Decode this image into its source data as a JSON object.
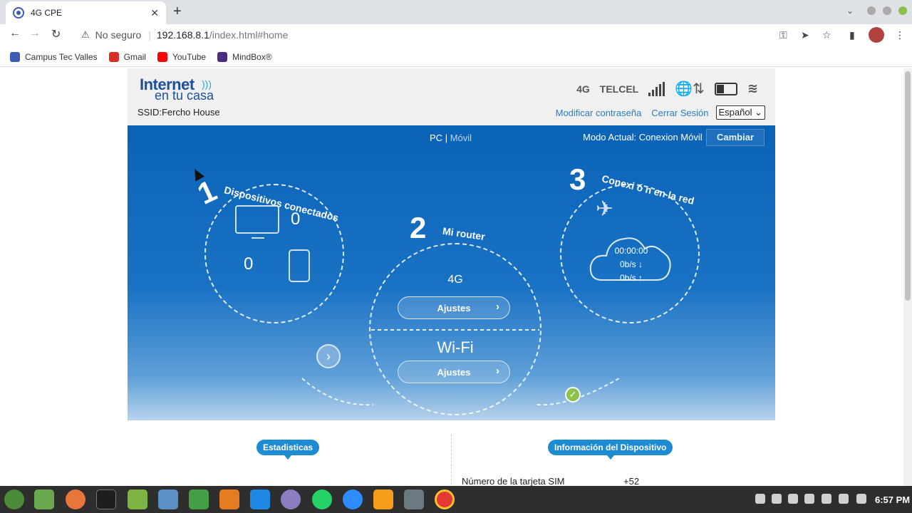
{
  "browser": {
    "tab_title": "4G CPE",
    "tab_close": "✕",
    "new_tab": "+",
    "security_label": "No seguro",
    "url_host": "192.168.8.1",
    "url_path": "/index.html#home",
    "bookmarks": [
      {
        "label": "Campus Tec Valles",
        "color": "#3b5bb5"
      },
      {
        "label": "Gmail",
        "color": "#d93025"
      },
      {
        "label": "YouTube",
        "color": "#ff0000"
      },
      {
        "label": "MindBox®",
        "color": "#4b2e83"
      }
    ]
  },
  "header": {
    "logo_line1": "Internet",
    "logo_line2": "en tu casa",
    "ssid": "SSID:Fercho House",
    "network_type": "4G",
    "carrier": "TELCEL",
    "modify_password": "Modificar contraseña",
    "logout": "Cerrar Sesión",
    "language": "Español"
  },
  "banner": {
    "view_pc": "PC",
    "view_separator": "|",
    "view_mobile": "Móvil",
    "mode_current": "Modo Actual: Conexion Móvil",
    "change_button": "Cambiar",
    "step1_number": "1",
    "step1_label": "Dispositivos conectados",
    "pc_count": "0",
    "mobile_count": "0",
    "step2_number": "2",
    "step2_label": "Mi router",
    "router_network": "4G",
    "settings_label": "Ajustes",
    "wifi_label": "Wi-Fi",
    "step3_number": "3",
    "step3_label": "Conexi ó n en la red",
    "connection_time": "00:00:00",
    "download_rate": "0b/s ↓",
    "upload_rate": "0b/s ↑"
  },
  "sections": {
    "stats_title": "Estadisticas",
    "device_info_title": "Información del Dispositivo",
    "sim_label": "Número de la tarjeta SIM",
    "sim_value": "+52"
  },
  "taskbar": {
    "clock": "6:57 PM"
  }
}
